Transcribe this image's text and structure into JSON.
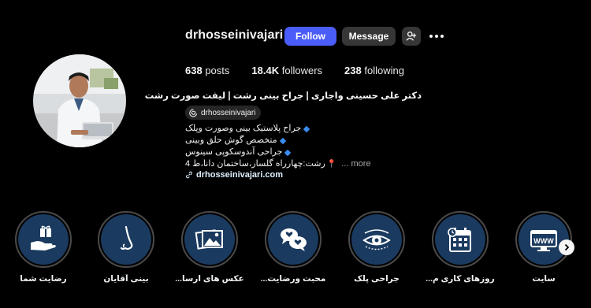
{
  "profile": {
    "username": "drhosseinivajari",
    "follow_label": "Follow",
    "message_label": "Message",
    "stats": [
      {
        "value": "638",
        "label": "posts"
      },
      {
        "value": "18.4K",
        "label": "followers"
      },
      {
        "value": "238",
        "label": "following"
      }
    ],
    "full_name": "دکتر علی حسینی واجاری | جراح بینی رشت | لیفت صورت رشت",
    "threads_handle": "drhosseinivajari",
    "bio": [
      "جراح پلاستیک بینی وصورت وپلک",
      "متخصص گوش حلق وبینی",
      "جراحی آندوسکوپی سینوس",
      "رشت:چهارراه گلسار،ساختمان دانا،ط 4"
    ],
    "more_label": "... more",
    "website": "drhosseinivajari.com"
  },
  "highlights": [
    {
      "label": "رضایت شما",
      "icon": "gift-hand-icon"
    },
    {
      "label": "بینی آقایان",
      "icon": "nose-icon"
    },
    {
      "label": "عکس های ارسا...",
      "icon": "photos-icon"
    },
    {
      "label": "محبت ورضایت...",
      "icon": "chat-hearts-icon"
    },
    {
      "label": "جراحی پلک",
      "icon": "eye-icon"
    },
    {
      "label": "روزهای کاری م...",
      "icon": "calendar-icon"
    },
    {
      "label": "سایت",
      "icon": "www-icon"
    }
  ],
  "colors": {
    "follow": "#4a5df9",
    "secondary_button": "#363636",
    "highlight_fill": "#1b3a5f",
    "bio_bullet": "#3a8df0"
  }
}
